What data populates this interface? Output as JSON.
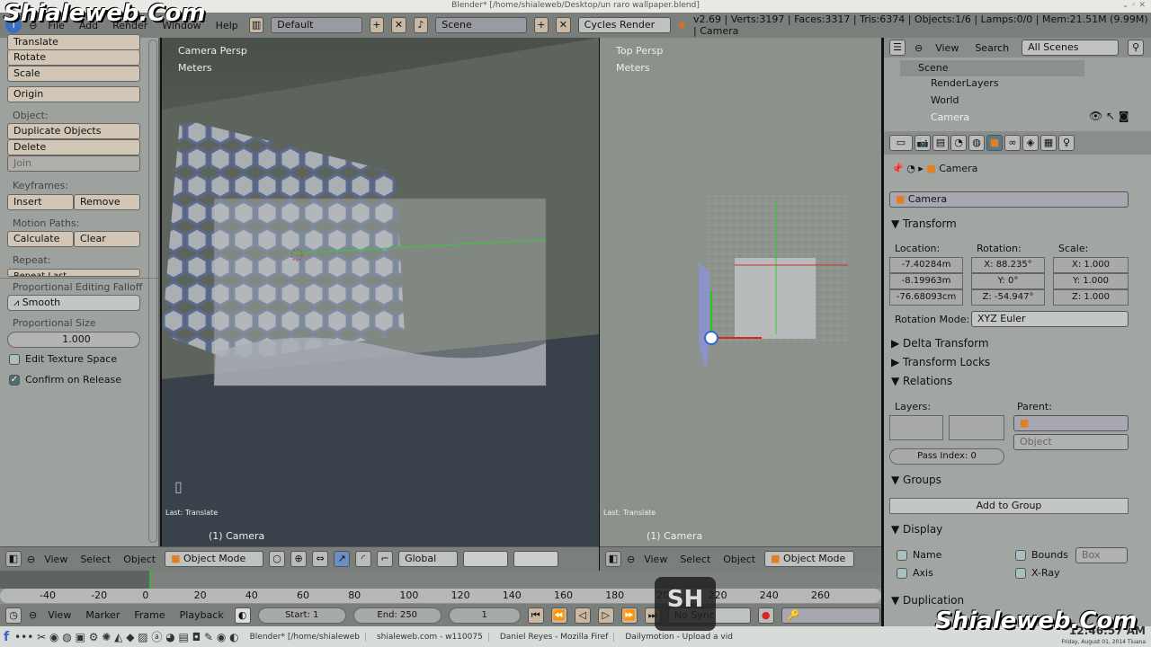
{
  "watermark": "Shialeweb.Com",
  "window_title": "Blender* [/home/shialeweb/Desktop/un raro wallpaper.blend]",
  "topbar": {
    "menus": [
      "File",
      "Add",
      "Render",
      "Window",
      "Help"
    ],
    "layout": "Default",
    "scene": "Scene",
    "engine": "Cycles Render",
    "stats": "v2.69 | Verts:3197 | Faces:3317 | Tris:6374 | Objects:1/6 | Lamps:0/0 | Mem:21.51M (9.99M) | Camera"
  },
  "toolbar": {
    "translate": "Translate",
    "rotate": "Rotate",
    "scale": "Scale",
    "origin": "Origin",
    "object_label": "Object:",
    "duplicate": "Duplicate Objects",
    "delete": "Delete",
    "join": "Join",
    "keyframes_label": "Keyframes:",
    "insert": "Insert",
    "remove": "Remove",
    "motion_label": "Motion Paths:",
    "calculate": "Calculate",
    "clear": "Clear",
    "repeat_label": "Repeat:",
    "repeat_last": "Repeat Last",
    "falloff_label": "Proportional Editing Falloff",
    "falloff": "Smooth",
    "prop_size_label": "Proportional Size",
    "prop_size": "1.000",
    "edit_texture": "Edit Texture Space",
    "confirm_release": "Confirm on Release"
  },
  "viewport_left": {
    "view": "Camera Persp",
    "units": "Meters",
    "last_op": "Last: Translate",
    "object": "(1) Camera"
  },
  "viewport_right": {
    "view": "Top Persp",
    "units": "Meters",
    "last_op": "Last: Translate",
    "object": "(1) Camera"
  },
  "view_header": {
    "view": "View",
    "select": "Select",
    "object": "Object",
    "mode": "Object Mode",
    "orientation": "Global"
  },
  "outliner": {
    "view": "View",
    "search": "Search",
    "filter": "All Scenes",
    "items": [
      "Scene",
      "RenderLayers",
      "World",
      "Camera"
    ]
  },
  "properties": {
    "breadcrumb": "Camera",
    "name": "Camera",
    "transform": "Transform",
    "location_label": "Location:",
    "rotation_label": "Rotation:",
    "scale_label": "Scale:",
    "location": [
      "-7.40284m",
      "-8.19963m",
      "-76.68093cm"
    ],
    "rotation": [
      "X: 88.235°",
      "Y: 0°",
      "Z: -54.947°"
    ],
    "scale": [
      "X: 1.000",
      "Y: 1.000",
      "Z: 1.000"
    ],
    "rotation_mode_label": "Rotation Mode:",
    "rotation_mode": "XYZ Euler",
    "delta": "Delta Transform",
    "locks": "Transform Locks",
    "relations": "Relations",
    "layers_label": "Layers:",
    "parent_label": "Parent:",
    "parent_type": "Object",
    "pass_index": "Pass Index: 0",
    "groups": "Groups",
    "add_group": "Add to Group",
    "display": "Display",
    "name_cb": "Name",
    "bounds_cb": "Bounds",
    "bounds_type": "Box",
    "axis_cb": "Axis",
    "xray_cb": "X-Ray",
    "duplication": "Duplication"
  },
  "timeline": {
    "ticks": [
      "-40",
      "-20",
      "0",
      "20",
      "40",
      "60",
      "80",
      "100",
      "120",
      "140",
      "160",
      "180",
      "200",
      "220",
      "240",
      "260"
    ],
    "view": "View",
    "marker": "Marker",
    "frame": "Frame",
    "playback": "Playback",
    "start": "Start: 1",
    "end": "End: 250",
    "current": "1",
    "sync": "No Sync"
  },
  "taskbar": {
    "tasks": [
      "Blender* [/home/shialeweb",
      "shialeweb.com - w110075",
      "Daniel Reyes - Mozilla Firef",
      "Dailymotion - Upload a vid"
    ],
    "clock": "12:46:57 AM",
    "date": "Friday, August 01, 2014 Tiuana"
  }
}
